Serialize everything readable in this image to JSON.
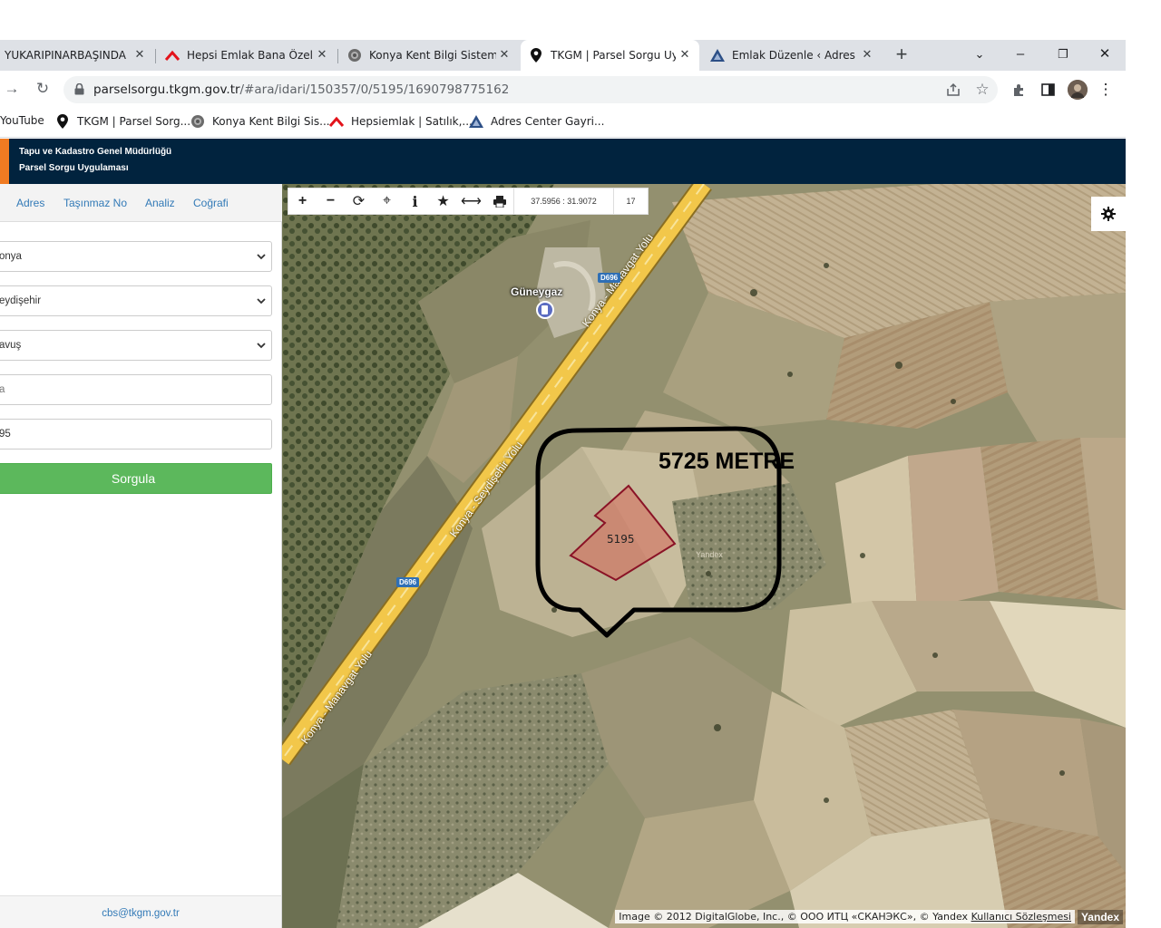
{
  "browser": {
    "tabs": [
      {
        "title": "YUKARIPINARBAŞINDA KO",
        "icon": "site-icon"
      },
      {
        "title": "Hepsi Emlak Bana Özel",
        "icon": "hepsiemlak-icon"
      },
      {
        "title": "Konya Kent Bilgi Sistemi",
        "icon": "konya-icon"
      },
      {
        "title": "TKGM | Parsel Sorgu Uygu",
        "icon": "location-pin-icon"
      },
      {
        "title": "Emlak Düzenle ‹ Adres Ce",
        "icon": "adres-center-icon"
      }
    ],
    "url_host": "parselsorgu.tkgm.gov.tr",
    "url_path": "/#ara/idari/150357/0/5195/1690798775162",
    "bookmarks": [
      {
        "label": "YouTube"
      },
      {
        "label": "TKGM | Parsel Sorg..."
      },
      {
        "label": "Konya Kent Bilgi Sis..."
      },
      {
        "label": "Hepsiemlak | Satılık,..."
      },
      {
        "label": "Adres Center Gayri..."
      }
    ]
  },
  "app": {
    "title_line1": "Tapu ve Kadastro Genel Müdürlüğü",
    "title_line2": "Parsel Sorgu Uygulaması",
    "accent_color": "#f07b22",
    "header_color": "#01233e"
  },
  "panel": {
    "tabs": [
      "Adres",
      "Taşınmaz No",
      "Analiz",
      "Coğrafi"
    ],
    "fields": {
      "il": "onya",
      "ilce": "eydişehir",
      "mahalle": "avuş",
      "ada": "a",
      "parsel": "95"
    },
    "submit_label": "Sorgula",
    "footer_email": "cbs@tkgm.gov.tr"
  },
  "map": {
    "coordinates": "37.5956 : 31.9072",
    "zoom": "17",
    "callout_text": "5725 METRE",
    "parcel_number": "5195",
    "poi_name": "Güneygaz",
    "road_labels": [
      "Konya - Manavgat Yolu",
      "Konya - Seydişehir Yolu",
      "Konya - Manavgat Yolu"
    ],
    "road_shield": "D696",
    "watermark": "Yandex",
    "attribution_text": "Image © 2012 DigitalGlobe, Inc., © ООО ИТЦ «СКАНЭКС», © Yandex",
    "attribution_link": "Kullanıcı Sözleşmesi",
    "yandex_badge": "Yandex"
  }
}
